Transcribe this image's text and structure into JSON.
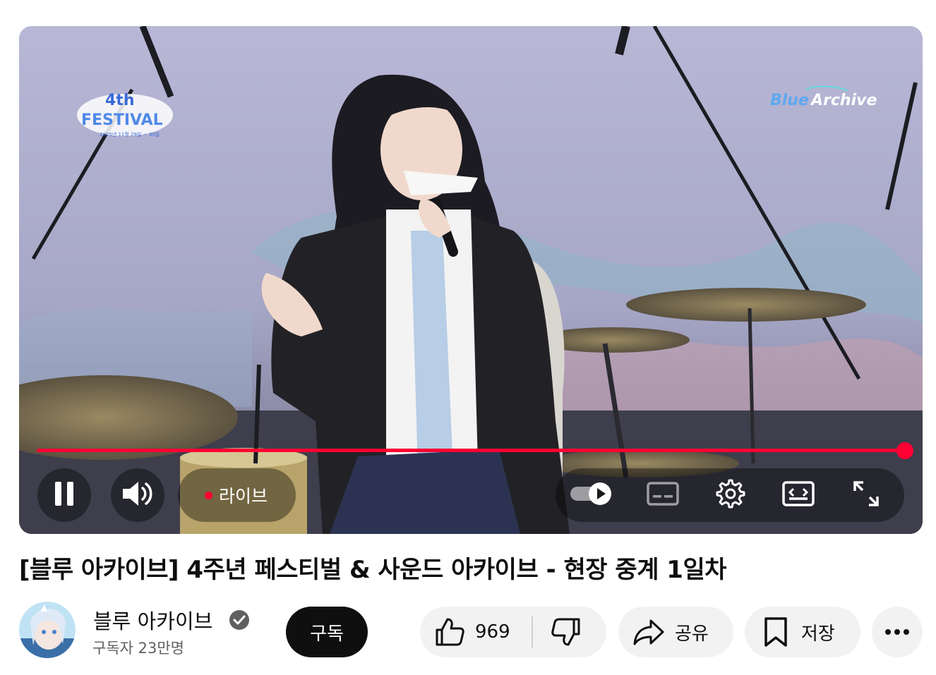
{
  "player": {
    "festival_logo_text": "4th FESTIVAL",
    "festival_logo_sub": "2025년 11월 29일 ~ 30일",
    "brand_logo_text": "BlueArchive",
    "live_label": "라이브",
    "progress": 1.0,
    "accent_color": "#ff0033",
    "controls": {
      "play_pause_icon": "pause-icon",
      "volume_icon": "volume-icon",
      "autoplay_icon": "autoplay-toggle-icon",
      "captions_icon": "captions-icon",
      "settings_icon": "gear-icon",
      "theater_icon": "theater-mode-icon",
      "fullscreen_icon": "fullscreen-icon"
    }
  },
  "video": {
    "title": "[블루 아카이브] 4주년 페스티벌 & 사운드 아카이브 - 현장 중계 1일차"
  },
  "channel": {
    "name": "블루 아카이브",
    "subscribers": "구독자 23만명",
    "subscribe_label": "구독"
  },
  "actions": {
    "like_count": "969",
    "share_label": "공유",
    "save_label": "저장"
  }
}
